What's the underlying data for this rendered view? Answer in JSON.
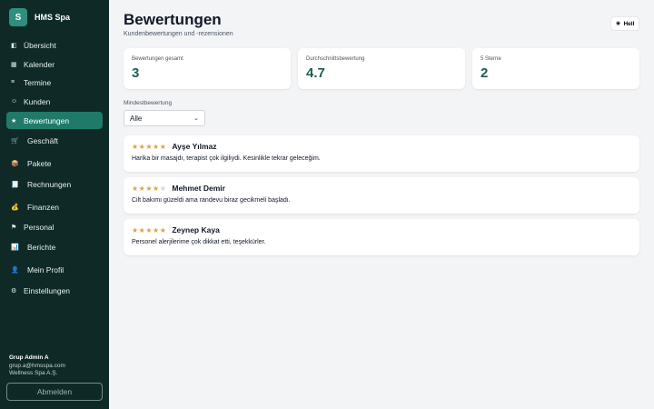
{
  "brand": {
    "logo_letter": "S",
    "name": "HMS Spa"
  },
  "nav": [
    {
      "icon": "◧",
      "label": "Übersicht",
      "active": false
    },
    {
      "icon": "▦",
      "label": "Kalender",
      "active": false
    },
    {
      "icon": "≡",
      "label": "Termine",
      "active": false
    },
    {
      "icon": "☺",
      "label": "Kunden",
      "active": false
    },
    {
      "icon": "★",
      "label": "Bewertungen",
      "active": true
    },
    {
      "icon": "🛒",
      "label": "Geschäft",
      "active": false
    },
    {
      "icon": "📦",
      "label": "Pakete",
      "active": false
    },
    {
      "icon": "🧾",
      "label": "Rechnungen",
      "active": false
    },
    {
      "icon": "💰",
      "label": "Finanzen",
      "active": false
    },
    {
      "icon": "⚑",
      "label": "Personal",
      "active": false
    },
    {
      "icon": "📊",
      "label": "Berichte",
      "active": false
    },
    {
      "icon": "👤",
      "label": "Mein Profil",
      "active": false
    },
    {
      "icon": "⚙",
      "label": "Einstellungen",
      "active": false
    }
  ],
  "user": {
    "name": "Grup Admin A",
    "email": "grup.a@hmsspa.com",
    "company": "Wellness Spa A.Ş."
  },
  "logout_label": "Abmelden",
  "page": {
    "title": "Bewertungen",
    "subtitle": "Kundenbewertungen und -rezensionen"
  },
  "theme_toggle": {
    "icon": "☀",
    "label": "Hell"
  },
  "stats": [
    {
      "label": "Bewertungen gesamt",
      "value": "3"
    },
    {
      "label": "Durchschnittsbewertung",
      "value": "4.7"
    },
    {
      "label": "5 Sterne",
      "value": "2"
    }
  ],
  "filter": {
    "label": "Mindestbewertung",
    "selected": "Alle"
  },
  "reviews": [
    {
      "stars": "★★★★★",
      "stars_empty": "",
      "rating": 5,
      "name": "Ayşe Yılmaz",
      "text": "Harika bir masajdı, terapist çok ilgiliydi. Kesinlikle tekrar geleceğim."
    },
    {
      "stars": "★★★★",
      "stars_empty": "★",
      "rating": 4,
      "name": "Mehmet Demir",
      "text": "Cilt bakımı güzeldi ama randevu biraz gecikmeli başladı."
    },
    {
      "stars": "★★★★★",
      "stars_empty": "",
      "rating": 5,
      "name": "Zeynep Kaya",
      "text": "Personel alerjilerime çok dikkat etti, teşekkürler."
    }
  ],
  "colors": {
    "sidebar_bg": "#0f2a26",
    "accent": "#1f7a69",
    "stat_value": "#1c5e52",
    "star": "#d9a441"
  }
}
